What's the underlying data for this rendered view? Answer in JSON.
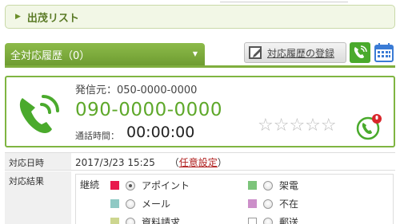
{
  "list_bar": {
    "label": "出茂リスト"
  },
  "history": {
    "select_label": "全対応履歴（0）"
  },
  "toolbar": {
    "register_label": "対応履歴の登録"
  },
  "call": {
    "caller_label": "発信元：",
    "caller_value": "050-0000-0000",
    "number": "090-0000-0000",
    "time_label": "通話時間：",
    "time_value": "00:00:00",
    "rating": 0,
    "rating_max": 5,
    "stars_text": "☆☆☆☆☆"
  },
  "detail": {
    "date_header": "対応日時",
    "date_value": "2017/3/23 15:25",
    "free_setting_open": "（",
    "free_setting_label": "任意設定",
    "free_setting_close": "）",
    "result_header": "対応結果",
    "continue_label": "継続",
    "options": [
      {
        "label": "アポイント",
        "color": "#e8194c",
        "selected": true
      },
      {
        "label": "架電",
        "color": "#7cc47a",
        "selected": false
      },
      {
        "label": "メール",
        "color": "#8fc9c4",
        "selected": false
      },
      {
        "label": "不在",
        "color": "#cc8fc9",
        "selected": false
      },
      {
        "label": "資料請求",
        "color": "#cdd68f",
        "selected": false
      },
      {
        "label": "郵送",
        "color": "#ffffff",
        "selected": false
      }
    ]
  },
  "colors": {
    "accent": "#6e9c31",
    "number": "#5ea82a",
    "link": "#b0201f"
  }
}
